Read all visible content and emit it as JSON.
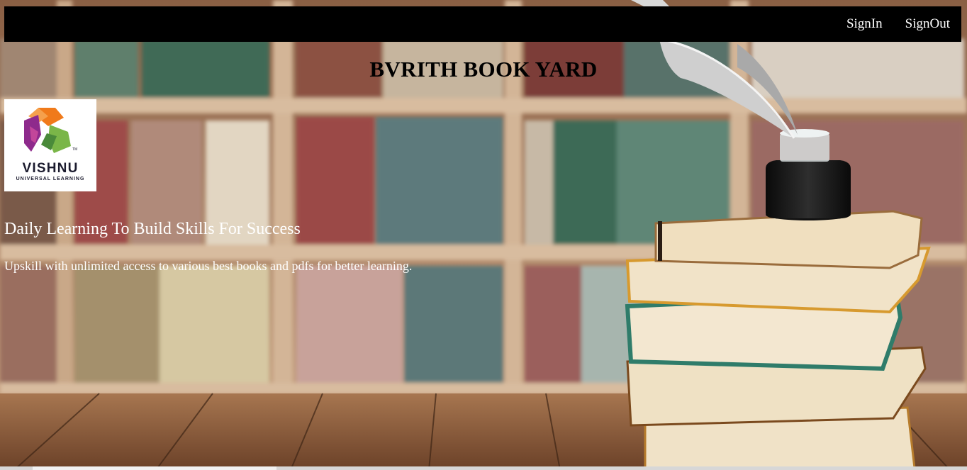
{
  "nav": {
    "signin_label": "SignIn",
    "signout_label": "SignOut"
  },
  "site_title": "BVRITH BOOK YARD",
  "logo": {
    "word": "VISHNU",
    "tagline": "UNIVERSAL LEARNING",
    "tm": "TM"
  },
  "hero": {
    "heading": "Daily Learning To Build Skills For Success",
    "subtext": "Upskill with unlimited access to various best books and pdfs for better learning."
  },
  "colors": {
    "navbar_bg": "#000000",
    "logo_orange": "#f07a1a",
    "logo_purple": "#8e2a8c",
    "logo_green": "#7ab648"
  },
  "icons": {
    "logo": "vishnu-logo",
    "background": "library-books-background"
  }
}
